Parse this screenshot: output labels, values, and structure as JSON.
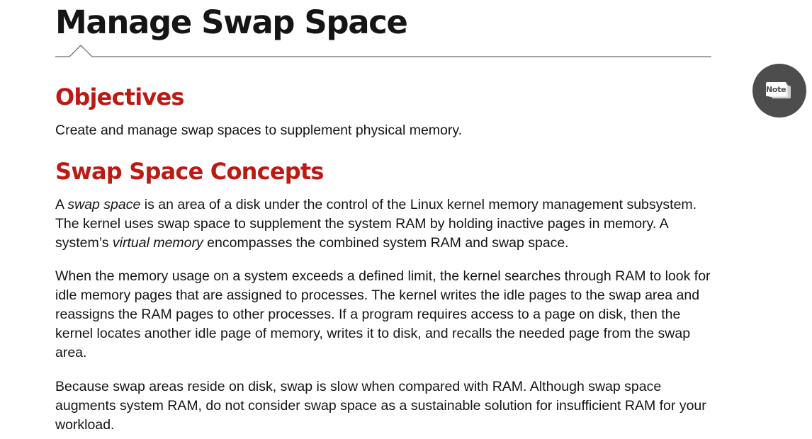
{
  "page": {
    "title": "Manage Swap Space"
  },
  "sections": {
    "objectives": {
      "heading": "Objectives",
      "text": "Create and manage swap spaces to supplement physical memory."
    },
    "concepts": {
      "heading": "Swap Space Concepts",
      "p1": {
        "s1": "A ",
        "em1": "swap space",
        "s2": " is an area of a disk under the control of the Linux kernel memory management subsystem. The kernel uses swap space to supplement the system RAM by holding inactive pages in memory. A system’s ",
        "em2": "virtual memory",
        "s3": " encompasses the combined system RAM and swap space."
      },
      "p2": "When the memory usage on a system exceeds a defined limit, the kernel searches through RAM to look for idle memory pages that are assigned to processes. The kernel writes the idle pages to the swap area and reassigns the RAM pages to other processes. If a program requires access to a page on disk, then the kernel locates another idle page of memory, writes it to disk, and recalls the needed page from the swap area.",
      "p3": "Because swap areas reside on disk, swap is slow when compared with RAM. Although swap space augments system RAM, do not consider swap space as a sustainable solution for insufficient RAM for your workload."
    }
  },
  "note_button": {
    "label": "Note",
    "icon": "note-icon",
    "color": "#4d4d4d"
  },
  "colors": {
    "heading_red": "#be1a14",
    "text": "#151515"
  }
}
